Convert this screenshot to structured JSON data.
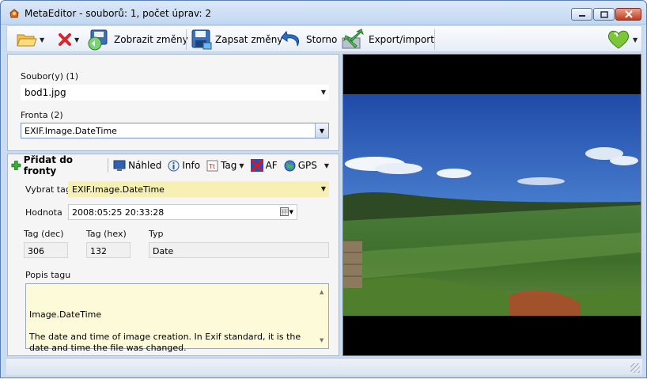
{
  "window": {
    "title": "MetaEditor - souborů: 1, počet úprav: 2"
  },
  "toolbar": {
    "show_changes": "Zobrazit změny",
    "write_changes": "Zapsat změny",
    "cancel": "Storno",
    "export_import": "Export/import"
  },
  "files": {
    "label": "Soubor(y) (1)",
    "value": "bod1.jpg"
  },
  "queue": {
    "label": "Fronta (2)",
    "value": "EXIF.Image.DateTime"
  },
  "tag_toolbar": {
    "add_to_queue": "Přidat do fronty",
    "preview": "Náhled",
    "info": "Info",
    "tag": "Tag",
    "af": "AF",
    "gps": "GPS"
  },
  "tag_form": {
    "select_tag_label": "Vybrat tag",
    "select_tag_value": "EXIF.Image.DateTime",
    "value_label": "Hodnota",
    "value_value": "2008:05:25 20:33:28",
    "tag_dec_label": "Tag (dec)",
    "tag_dec_value": "306",
    "tag_hex_label": "Tag (hex)",
    "tag_hex_value": "132",
    "type_label": "Typ",
    "type_value": "Date",
    "desc_label": "Popis tagu",
    "desc_value": "Image.DateTime\n\nThe date and time of image creation. In Exif standard, it is the date and time the file was changed."
  },
  "colors": {
    "title_bg": "#c9dcf3",
    "field_yellow": "#f7f0b4",
    "memo_bg": "#fcfad9",
    "preview_bg": "#000000"
  }
}
